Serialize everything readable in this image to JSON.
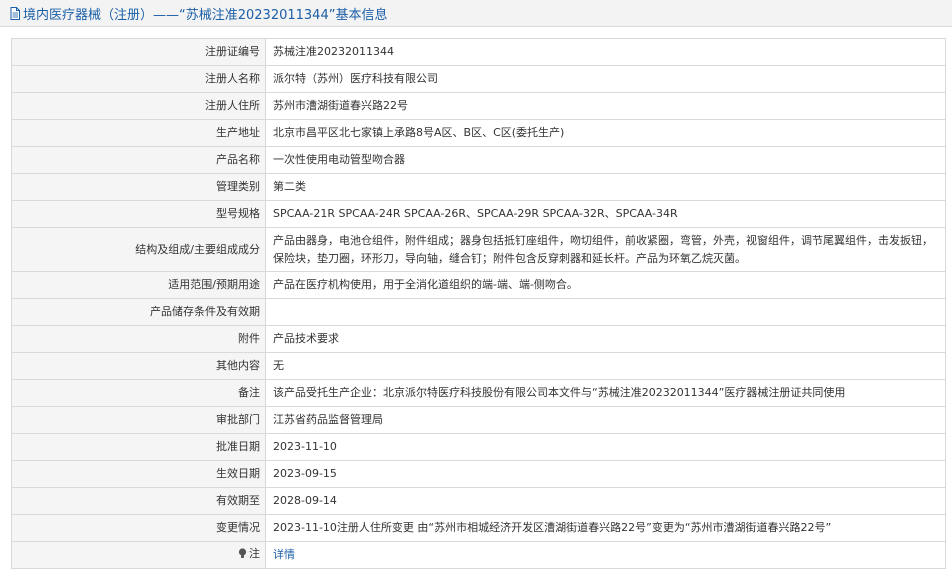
{
  "header": {
    "title": "境内医疗器械（注册）——“苏械注准20232011344”基本信息"
  },
  "rows": [
    {
      "label": "注册证编号",
      "value": "苏械注准20232011344"
    },
    {
      "label": "注册人名称",
      "value": "派尔特（苏州）医疗科技有限公司"
    },
    {
      "label": "注册人住所",
      "value": "苏州市漕湖街道春兴路22号"
    },
    {
      "label": "生产地址",
      "value": "北京市昌平区北七家镇上承路8号A区、B区、C区(委托生产)"
    },
    {
      "label": "产品名称",
      "value": "一次性使用电动管型吻合器"
    },
    {
      "label": "管理类别",
      "value": "第二类"
    },
    {
      "label": "型号规格",
      "value": "SPCAA-21R SPCAA-24R SPCAA-26R、SPCAA-29R SPCAA-32R、SPCAA-34R"
    },
    {
      "label": "结构及组成/主要组成成分",
      "value": "产品由器身，电池仓组件，附件组成；器身包括抵钉座组件，吻切组件，前收紧圈，弯管，外壳，视窗组件，调节尾翼组件，击发扳钮，保险块，垫刀圈，环形刀，导向轴，缝合钉；附件包含反穿刺器和延长杆。产品为环氧乙烷灭菌。"
    },
    {
      "label": "适用范围/预期用途",
      "value": "产品在医疗机构使用，用于全消化道组织的端-端、端-侧吻合。"
    },
    {
      "label": "产品储存条件及有效期",
      "value": ""
    },
    {
      "label": "附件",
      "value": "产品技术要求"
    },
    {
      "label": "其他内容",
      "value": "无"
    },
    {
      "label": "备注",
      "value": "该产品受托生产企业：北京派尔特医疗科技股份有限公司本文件与“苏械注准20232011344”医疗器械注册证共同使用"
    },
    {
      "label": "审批部门",
      "value": "江苏省药品监督管理局"
    },
    {
      "label": "批准日期",
      "value": "2023-11-10"
    },
    {
      "label": "生效日期",
      "value": "2023-09-15"
    },
    {
      "label": "有效期至",
      "value": "2028-09-14"
    },
    {
      "label": "变更情况",
      "value": "2023-11-10注册人住所变更 由“苏州市相城经济开发区漕湖街道春兴路22号”变更为“苏州市漕湖街道春兴路22号”"
    }
  ],
  "note_row": {
    "label": "注",
    "link_text": "详情",
    "icon": "warning-bulb-icon"
  },
  "colors": {
    "link": "#1b5fa8",
    "label_bg": "#f5f5f5",
    "border": "#d9d9d9"
  }
}
